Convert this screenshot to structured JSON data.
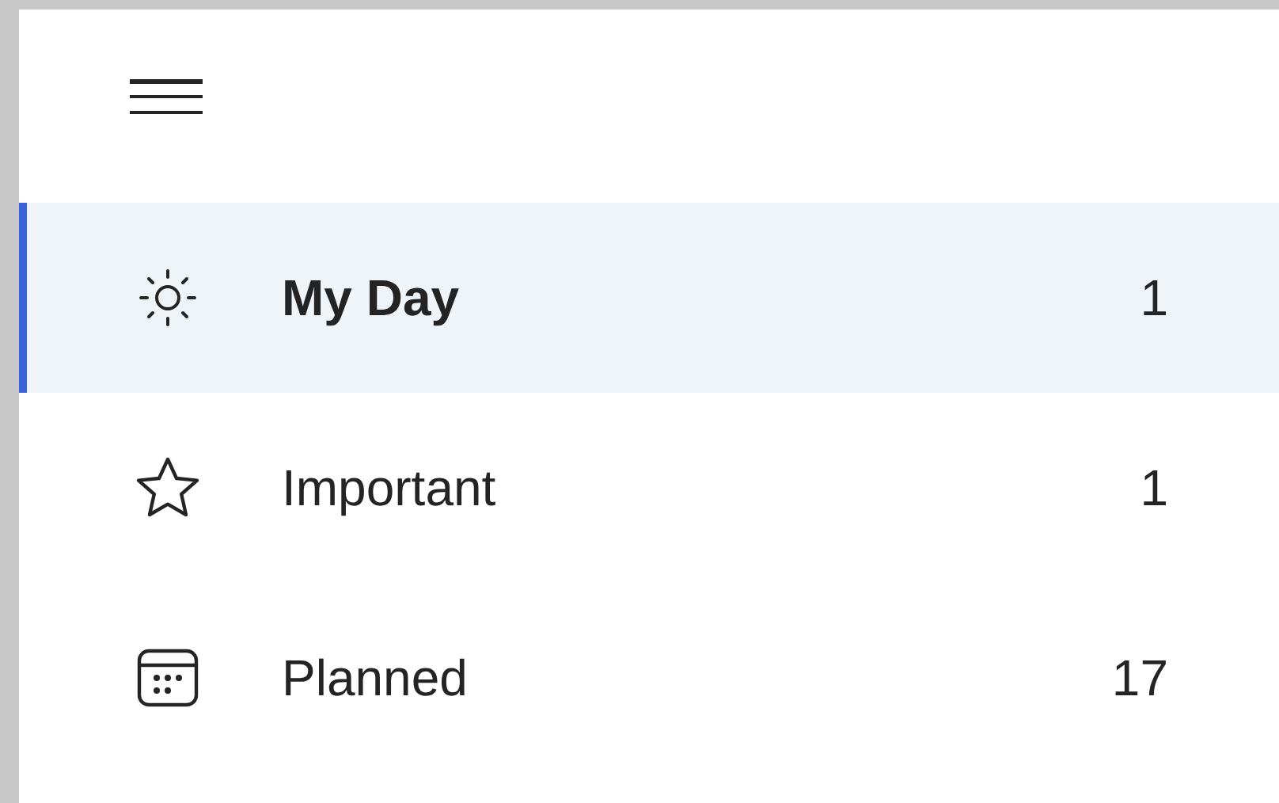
{
  "nav_items": [
    {
      "kind": "sun",
      "label": "My Day",
      "count": "1",
      "selected": true
    },
    {
      "kind": "star",
      "label": "Important",
      "count": "1",
      "selected": false
    },
    {
      "kind": "calendar",
      "label": "Planned",
      "count": "17",
      "selected": false
    }
  ]
}
